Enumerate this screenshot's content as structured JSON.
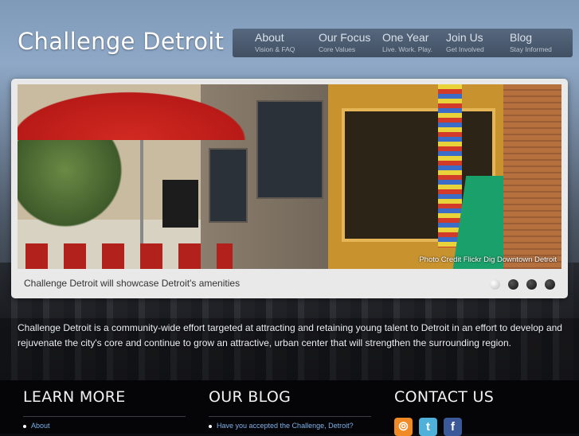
{
  "brand": {
    "logo_text": "Challenge Detroit"
  },
  "nav": [
    {
      "title": "About",
      "subtitle": "Vision & FAQ"
    },
    {
      "title": "Our Focus",
      "subtitle": "Core Values"
    },
    {
      "title": "One Year",
      "subtitle": "Live. Work. Play."
    },
    {
      "title": "Join Us",
      "subtitle": "Get Involved"
    },
    {
      "title": "Blog",
      "subtitle": "Stay Informed"
    }
  ],
  "slider": {
    "caption": "Challenge Detroit will showcase Detroit's amenities",
    "photo_credit": "Photo Credit Flickr Dig Downtown Detroit",
    "dots_count": 4,
    "active_dot": 1
  },
  "intro": "Challenge Detroit is a community-wide effort targeted at attracting and retaining young talent to Detroit in an effort to develop and rejuvenate the city's core and continue to grow an attractive, urban center that will strengthen the surrounding region.",
  "footer": {
    "learn_more": {
      "heading": "LEARN MORE",
      "links": [
        "About"
      ]
    },
    "blog": {
      "heading": "OUR BLOG",
      "links": [
        "Have you accepted the Challenge, Detroit?"
      ]
    },
    "contact": {
      "heading": "CONTACT US",
      "social": [
        "rss-icon",
        "twitter-icon",
        "facebook-icon"
      ]
    }
  },
  "colors": {
    "link": "#7fb0e8",
    "accent_red": "#b81a17"
  }
}
